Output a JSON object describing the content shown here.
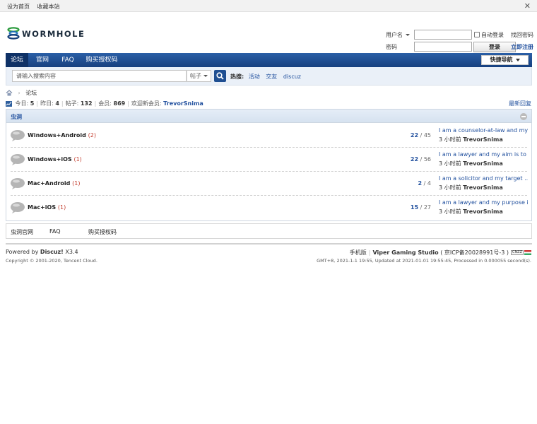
{
  "topbar": {
    "set_home": "设为首页",
    "bookmark": "收藏本站",
    "close_icon": "close-icon"
  },
  "brand": {
    "logo_text": "WORMHOLE",
    "logo_icon": "wormhole-logo-icon"
  },
  "login": {
    "username_label": "用户名",
    "password_label": "密码",
    "auto_login": "自动登录",
    "login_button": "登录",
    "find_password": "找回密码",
    "register": "立即注册",
    "username_value": "",
    "password_value": ""
  },
  "nav": {
    "items": [
      "论坛",
      "官网",
      "FAQ",
      "购买授权码"
    ],
    "active_index": 0,
    "quick_nav": "快捷导航"
  },
  "search": {
    "placeholder": "请输入搜索内容",
    "type": "帖子",
    "hot_label": "热搜:",
    "hot_terms": [
      "活动",
      "交友",
      "discuz"
    ]
  },
  "breadcrumb": {
    "home_icon": "home-icon",
    "current": "论坛"
  },
  "stats": {
    "today_label": "今日:",
    "today": "5",
    "yesterday_label": "昨日:",
    "yesterday": "4",
    "posts_label": "帖子:",
    "posts": "132",
    "members_label": "会员:",
    "members": "869",
    "welcome_label": "欢迎新会员:",
    "newest_member": "TrevorSnima",
    "latest_replies": "最新回复"
  },
  "forum": {
    "category": "虫洞",
    "boards": [
      {
        "name": "Windows+Android",
        "today": "(2)",
        "threads": "22",
        "posts": "45",
        "last_title": "I am a counselor-at-law and my ...",
        "last_time": "3 小时前",
        "last_user": "TrevorSnima"
      },
      {
        "name": "Windows+iOS",
        "today": "(1)",
        "threads": "22",
        "posts": "56",
        "last_title": "I am a lawyer and my aim is to ...",
        "last_time": "3 小时前",
        "last_user": "TrevorSnima"
      },
      {
        "name": "Mac+Android",
        "today": "(1)",
        "threads": "2",
        "posts": "4",
        "last_title": "I am a solicitor and my target ...",
        "last_time": "3 小时前",
        "last_user": "TrevorSnima"
      },
      {
        "name": "Mac+iOS",
        "today": "(1)",
        "threads": "15",
        "posts": "27",
        "last_title": "I am a lawyer and my purpose i ...",
        "last_time": "3 小时前",
        "last_user": "TrevorSnima"
      }
    ]
  },
  "footer_links": [
    "虫洞官网",
    "FAQ",
    "购买授权码"
  ],
  "footer": {
    "powered_by": "Powered by",
    "product": "Discuz!",
    "version": "X3.4",
    "copyright": "Copyright © 2001-2020, Tencent Cloud.",
    "mobile": "手机版",
    "studio": "Viper Gaming Studio",
    "icp": "( 京ICP备20028991号-3 )",
    "badge": "CNZZ",
    "timing": "GMT+8, 2021-1-1 19:55, Updated at 2021-01-01 19:55:45, Processed in 0.000055 second(s)."
  }
}
